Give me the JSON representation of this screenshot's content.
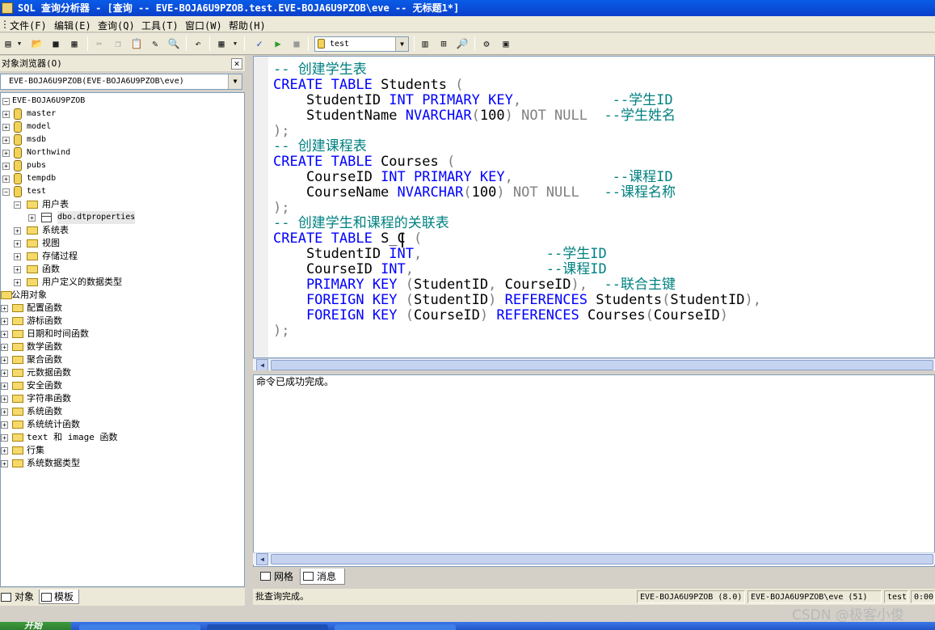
{
  "window": {
    "title": "SQL 查询分析器 - [查询 -- EVE-BOJA6U9PZOB.test.EVE-BOJA6U9PZOB\\eve -- 无标题1*]"
  },
  "menu": [
    "文件(F)",
    "编辑(E)",
    "查询(Q)",
    "工具(T)",
    "窗口(W)",
    "帮助(H)"
  ],
  "toolbar": {
    "icons": [
      "new-query-icon",
      "open-icon",
      "save-icon",
      "insert-template-icon",
      "cut-icon",
      "copy-icon",
      "paste-icon",
      "clear-icon",
      "find-icon",
      "undo-icon",
      "results-mode-icon",
      "parse-icon",
      "execute-icon",
      "stop-icon",
      "object-browser-icon",
      "object-search-icon",
      "show-plan-icon",
      "options-icon",
      "show-results-icon"
    ],
    "database": "test"
  },
  "object_browser": {
    "header": "对象浏览器(O)",
    "server_combo": "EVE-BOJA6U9PZOB(EVE-BOJA6U9PZOB\\eve)",
    "tree": {
      "server": "EVE-BOJA6U9PZOB",
      "databases": [
        "master",
        "model",
        "msdb",
        "Northwind",
        "pubs",
        "tempdb",
        "test"
      ],
      "test_children": {
        "user_tables": "用户表",
        "table": "dbo.dtproperties",
        "folders": [
          "系统表",
          "视图",
          "存储过程",
          "函数",
          "用户定义的数据类型"
        ]
      },
      "public_objects": "公用对象",
      "public_folders": [
        "配置函数",
        "游标函数",
        "日期和时间函数",
        "数学函数",
        "聚合函数",
        "元数据函数",
        "安全函数",
        "字符串函数",
        "系统函数",
        "系统统计函数",
        "text 和 image 函数",
        "行集",
        "系统数据类型"
      ]
    },
    "tabs": [
      "对象",
      "模板"
    ]
  },
  "editor": {
    "lines": [
      [
        {
          "t": "-- 创建学生表",
          "c": "cm"
        }
      ],
      [
        {
          "t": "CREATE TABLE",
          "c": "kw"
        },
        {
          "t": " Students ",
          "c": "tx"
        },
        {
          "t": "(",
          "c": "gy"
        }
      ],
      [
        {
          "t": "    StudentID ",
          "c": "tx"
        },
        {
          "t": "INT PRIMARY KEY",
          "c": "kw"
        },
        {
          "t": ",",
          "c": "gy"
        },
        {
          "t": "           ",
          "c": "tx"
        },
        {
          "t": "--学生ID",
          "c": "cm"
        }
      ],
      [
        {
          "t": "    StudentName ",
          "c": "tx"
        },
        {
          "t": "NVARCHAR",
          "c": "kw"
        },
        {
          "t": "(",
          "c": "gy"
        },
        {
          "t": "100",
          "c": "tx"
        },
        {
          "t": ") NOT NULL",
          "c": "gy"
        },
        {
          "t": "  ",
          "c": "tx"
        },
        {
          "t": "--学生姓名",
          "c": "cm"
        }
      ],
      [
        {
          "t": ");",
          "c": "gy"
        }
      ],
      [
        {
          "t": "-- 创建课程表",
          "c": "cm"
        }
      ],
      [
        {
          "t": "CREATE TABLE",
          "c": "kw"
        },
        {
          "t": " Courses ",
          "c": "tx"
        },
        {
          "t": "(",
          "c": "gy"
        }
      ],
      [
        {
          "t": "    CourseID ",
          "c": "tx"
        },
        {
          "t": "INT PRIMARY KEY",
          "c": "kw"
        },
        {
          "t": ",",
          "c": "gy"
        },
        {
          "t": "            ",
          "c": "tx"
        },
        {
          "t": "--课程ID",
          "c": "cm"
        }
      ],
      [
        {
          "t": "    CourseName ",
          "c": "tx"
        },
        {
          "t": "NVARCHAR",
          "c": "kw"
        },
        {
          "t": "(",
          "c": "gy"
        },
        {
          "t": "100",
          "c": "tx"
        },
        {
          "t": ") NOT NULL",
          "c": "gy"
        },
        {
          "t": "   ",
          "c": "tx"
        },
        {
          "t": "--课程名称",
          "c": "cm"
        }
      ],
      [
        {
          "t": ");",
          "c": "gy"
        }
      ],
      [
        {
          "t": "-- 创建学生和课程的关联表",
          "c": "cm"
        }
      ],
      [
        {
          "t": "CREATE TABLE",
          "c": "kw"
        },
        {
          "t": " S_C ",
          "c": "tx"
        },
        {
          "t": "(",
          "c": "gy"
        }
      ],
      [
        {
          "t": "    StudentID ",
          "c": "tx"
        },
        {
          "t": "INT",
          "c": "kw"
        },
        {
          "t": ",",
          "c": "gy"
        },
        {
          "t": "               ",
          "c": "tx"
        },
        {
          "t": "--学生ID",
          "c": "cm"
        }
      ],
      [
        {
          "t": "    CourseID ",
          "c": "tx"
        },
        {
          "t": "INT",
          "c": "kw"
        },
        {
          "t": ",",
          "c": "gy"
        },
        {
          "t": "                ",
          "c": "tx"
        },
        {
          "t": "--课程ID",
          "c": "cm"
        }
      ],
      [
        {
          "t": "    PRIMARY KEY",
          "c": "kw"
        },
        {
          "t": " (",
          "c": "gy"
        },
        {
          "t": "StudentID",
          "c": "tx"
        },
        {
          "t": ", ",
          "c": "gy"
        },
        {
          "t": "CourseID",
          "c": "tx"
        },
        {
          "t": "),",
          "c": "gy"
        },
        {
          "t": "  ",
          "c": "tx"
        },
        {
          "t": "--联合主键",
          "c": "cm"
        }
      ],
      [
        {
          "t": "    FOREIGN KEY",
          "c": "kw"
        },
        {
          "t": " (",
          "c": "gy"
        },
        {
          "t": "StudentID",
          "c": "tx"
        },
        {
          "t": ") ",
          "c": "gy"
        },
        {
          "t": "REFERENCES",
          "c": "kw"
        },
        {
          "t": " Students",
          "c": "tx"
        },
        {
          "t": "(",
          "c": "gy"
        },
        {
          "t": "StudentID",
          "c": "tx"
        },
        {
          "t": "),",
          "c": "gy"
        }
      ],
      [
        {
          "t": "    FOREIGN KEY",
          "c": "kw"
        },
        {
          "t": " (",
          "c": "gy"
        },
        {
          "t": "CourseID",
          "c": "tx"
        },
        {
          "t": ") ",
          "c": "gy"
        },
        {
          "t": "REFERENCES",
          "c": "kw"
        },
        {
          "t": " Courses",
          "c": "tx"
        },
        {
          "t": "(",
          "c": "gy"
        },
        {
          "t": "CourseID",
          "c": "tx"
        },
        {
          "t": ")",
          "c": "gy"
        }
      ],
      [
        {
          "t": ");",
          "c": "gy"
        }
      ]
    ]
  },
  "results": {
    "message": "命令已成功完成。",
    "tabs": [
      "网格",
      "消息"
    ],
    "active_tab": "消息"
  },
  "statusbar": {
    "left": "批查询完成。",
    "server": "EVE-BOJA6U9PZOB (8.0)",
    "user": "EVE-BOJA6U9PZOB\\eve (51)",
    "db": "test",
    "time": "0:00:"
  },
  "taskbar": {
    "start": "开始"
  },
  "watermark": "CSDN @极客小俊",
  "colors": {
    "keyword": "#0000ff",
    "comment": "#008080",
    "operator": "#808080",
    "titlebar": "#0a5ce8"
  }
}
